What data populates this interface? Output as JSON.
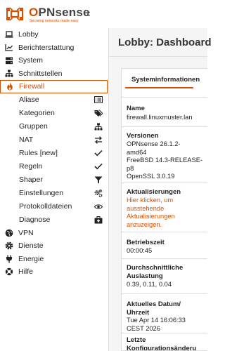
{
  "brand": {
    "name_o": "O",
    "name_rest": "PNsense",
    "tagline": "Securing networks made easy",
    "mark_color": "#d94f00"
  },
  "header": {
    "collapse_icon": "chevron-left-icon",
    "collapse_glyph": "‹"
  },
  "sidebar": {
    "items": [
      {
        "label": "Lobby",
        "icon": "laptop-icon"
      },
      {
        "label": "Berichterstattung",
        "icon": "chart-icon"
      },
      {
        "label": "System",
        "icon": "server-icon"
      },
      {
        "label": "Schnittstellen",
        "icon": "sitemap-icon"
      },
      {
        "label": "Firewall",
        "icon": "fire-icon",
        "active": true
      }
    ],
    "firewall_sub": [
      {
        "label": "Aliase",
        "icon": "list-icon"
      },
      {
        "label": "Kategorien",
        "icon": "tags-icon"
      },
      {
        "label": "Gruppen",
        "icon": "sitemap-icon"
      },
      {
        "label": "NAT",
        "icon": "exchange-icon"
      },
      {
        "label": "Rules [new]",
        "icon": "check-icon"
      },
      {
        "label": "Regeln",
        "icon": "check-icon"
      },
      {
        "label": "Shaper",
        "icon": "filter-icon"
      },
      {
        "label": "Einstellungen",
        "icon": "cogs-icon"
      },
      {
        "label": "Protokolldateien",
        "icon": "eye-icon"
      },
      {
        "label": "Diagnose",
        "icon": "medkit-icon"
      }
    ],
    "bottom_items": [
      {
        "label": "VPN",
        "icon": "globe-icon"
      },
      {
        "label": "Dienste",
        "icon": "gear-icon"
      },
      {
        "label": "Energie",
        "icon": "plug-icon"
      },
      {
        "label": "Hilfe",
        "icon": "lifebuoy-icon"
      }
    ]
  },
  "main": {
    "title": "Lobby: Dashboard",
    "card": {
      "title": "Systeminformationen",
      "sections": [
        {
          "key": "Name",
          "value": "firewall.linuxmuster.lan"
        },
        {
          "key": "Versionen",
          "value": "OPNsense 26.1.2-\namd64\nFreeBSD 14.3-RELEASE-\np8\nOpenSSL 3.0.19"
        },
        {
          "key": "Aktualisierungen",
          "value": "Hier klicken, um\nausstehende\nAktualisierungen\nanzuzeigen."
        },
        {
          "key": "Betriebszeit",
          "value": "00:00:45"
        },
        {
          "key": "Durchschnittliche\nAuslastung",
          "value": "0.39, 0.11, 0.04"
        },
        {
          "key": "Aktuelles Datum/\nUhrzeit",
          "value": "Tue Apr 14 16:06:33\nCEST 2026"
        },
        {
          "key": "Letzte\nKonfigurationsänderu",
          "value": ""
        }
      ]
    }
  }
}
